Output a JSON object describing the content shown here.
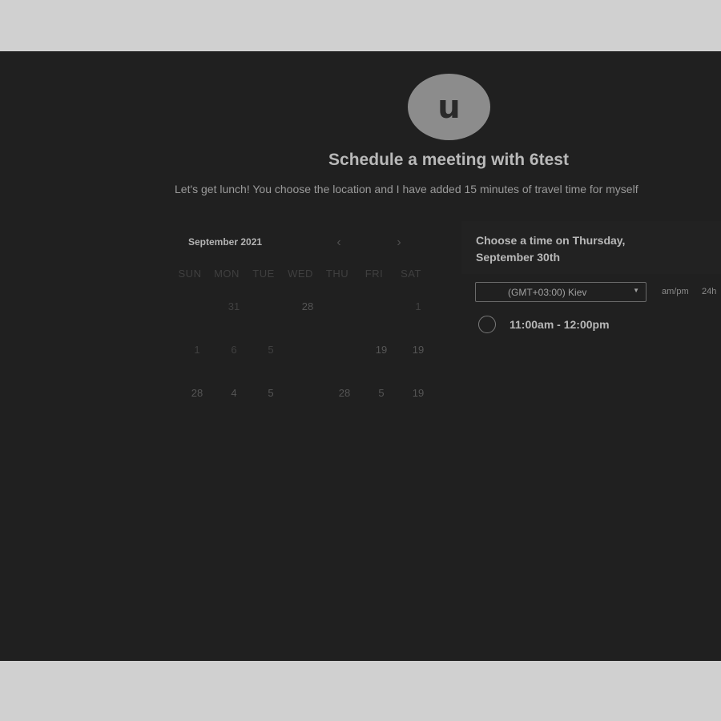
{
  "host": {
    "avatar_letter": "u",
    "title": "Schedule a meeting with 6test",
    "description": "Let's get lunch! You choose the location and I have added 15 minutes of travel time for myself"
  },
  "calendar": {
    "month_label": "September 2021",
    "prev_icon": "chevron-left-icon",
    "next_icon": "chevron-right-icon",
    "prev_glyph": "‹",
    "next_glyph": "›",
    "weekdays": [
      "SUN",
      "MON",
      "TUE",
      "WED",
      "THU",
      "FRI",
      "SAT"
    ],
    "rows": [
      [
        "",
        "31",
        "",
        "28",
        "",
        "",
        "1"
      ],
      [
        "1",
        "6",
        "5",
        "",
        "",
        "19",
        "19"
      ],
      [
        "28",
        "4",
        "5",
        "",
        "28",
        "5",
        "19"
      ],
      [
        "",
        "",
        "",
        "",
        "",
        "",
        ""
      ],
      [
        "",
        "",
        "",
        "",
        "",
        "",
        ""
      ]
    ]
  },
  "times": {
    "heading": "Choose a time on Thursday, September 30th",
    "timezone": "(GMT+03:00) Kiev",
    "format_ampm": "am/pm",
    "format_24h": "24h",
    "slots": [
      "11:00am - 12:00pm"
    ]
  }
}
